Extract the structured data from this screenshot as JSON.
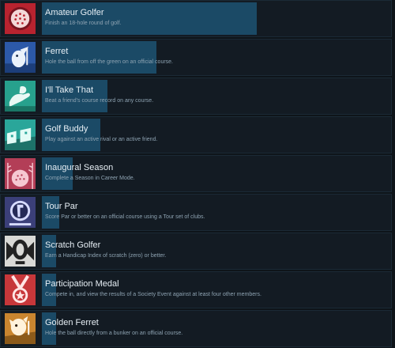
{
  "achievements": [
    {
      "title": "Amateur Golfer",
      "desc": "Finish an 18-hole round of golf.",
      "progress": 0.62,
      "icon": "golf-ball-icon",
      "colors": {
        "bg": "#b8232f",
        "fg": "#f3d8d8"
      }
    },
    {
      "title": "Ferret",
      "desc": "Hole the ball from off the green on an official course.",
      "progress": 0.33,
      "icon": "ferret-icon",
      "colors": {
        "bg": "#2c59a8",
        "fg": "#eaf2fb"
      }
    },
    {
      "title": "I'll Take That",
      "desc": "Beat a friend's course record on any course.",
      "progress": 0.19,
      "icon": "hand-grab-icon",
      "colors": {
        "bg": "#27a18d",
        "fg": "#e9f8f4"
      }
    },
    {
      "title": "Golf Buddy",
      "desc": "Play against an active rival or an active friend.",
      "progress": 0.17,
      "icon": "buddies-icon",
      "colors": {
        "bg": "#2aa69a",
        "fg": "#e3fbf6"
      }
    },
    {
      "title": "Inaugural Season",
      "desc": "Complete a Season in Career Mode.",
      "progress": 0.09,
      "icon": "season-ball-icon",
      "colors": {
        "bg": "#b33e57",
        "fg": "#f6c8d2"
      }
    },
    {
      "title": "Tour Par",
      "desc": "Score Par or better on an official course using a Tour set of clubs.",
      "progress": 0.05,
      "icon": "tour-par-icon",
      "colors": {
        "bg": "#3b3f79",
        "fg": "#d7dbff"
      }
    },
    {
      "title": "Scratch Golfer",
      "desc": "Earn a Handicap Index of scratch (zero) or better.",
      "progress": 0.04,
      "icon": "scratch-zero-icon",
      "colors": {
        "bg": "#d9d9d6",
        "fg": "#222222"
      }
    },
    {
      "title": "Participation Medal",
      "desc": "Compete in, and view the results of a Society Event against at least four other members.",
      "progress": 0.03,
      "icon": "medal-icon",
      "colors": {
        "bg": "#c7373a",
        "fg": "#ffe5e5"
      }
    },
    {
      "title": "Golden Ferret",
      "desc": "Hole the ball directly from a bunker on an official course.",
      "progress": 0.02,
      "icon": "golden-ferret-icon",
      "colors": {
        "bg": "#c9852f",
        "fg": "#fff2dc"
      }
    }
  ]
}
